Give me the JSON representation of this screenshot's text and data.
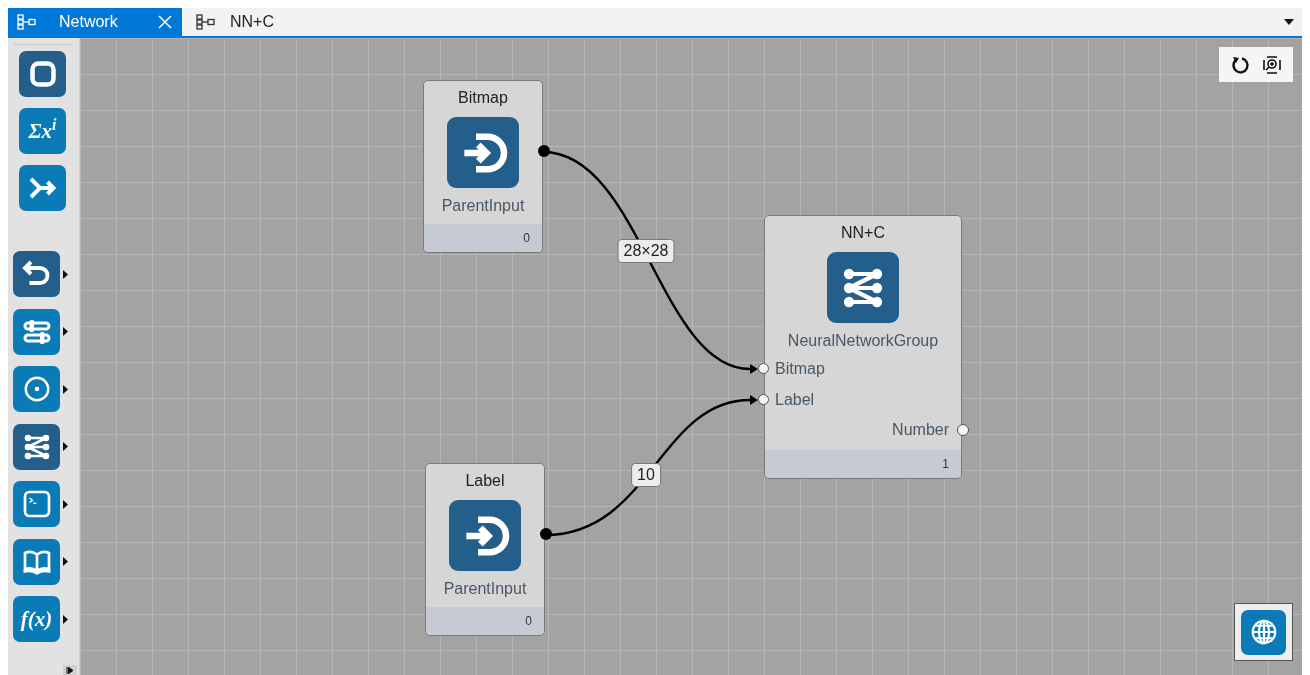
{
  "tabs": [
    {
      "label": "Network",
      "selected": true
    },
    {
      "label": "NN+C",
      "selected": false
    }
  ],
  "palette_groups": [
    {
      "items": [
        {
          "kind": "square",
          "has_menu": false
        },
        {
          "kind": "glyph",
          "glyph": "Σx$^{i}$",
          "has_menu": false
        },
        {
          "kind": "merge",
          "has_menu": false
        }
      ]
    },
    {
      "items": [
        {
          "kind": "undo",
          "has_menu": true
        },
        {
          "kind": "sliders",
          "has_menu": true
        },
        {
          "kind": "target",
          "has_menu": true
        },
        {
          "kind": "network",
          "has_menu": true
        },
        {
          "kind": "terminal",
          "has_menu": true
        },
        {
          "kind": "book",
          "has_menu": true
        },
        {
          "kind": "glyph",
          "glyph": "f(x)",
          "has_menu": true
        }
      ]
    }
  ],
  "nodes": [
    {
      "title": "Bitmap",
      "kind": "input",
      "type": "ParentInput",
      "footer": "0"
    },
    {
      "title": "Label",
      "kind": "input",
      "type": "ParentInput",
      "footer": "0"
    },
    {
      "title": "NN+C",
      "kind": "network",
      "type": "NeuralNetworkGroup",
      "footer": "1",
      "inputs": [
        "Bitmap",
        "Label"
      ],
      "outputs": [
        "Number"
      ]
    }
  ],
  "edges": [
    {
      "label": "28×28"
    },
    {
      "label": "10"
    }
  ]
}
